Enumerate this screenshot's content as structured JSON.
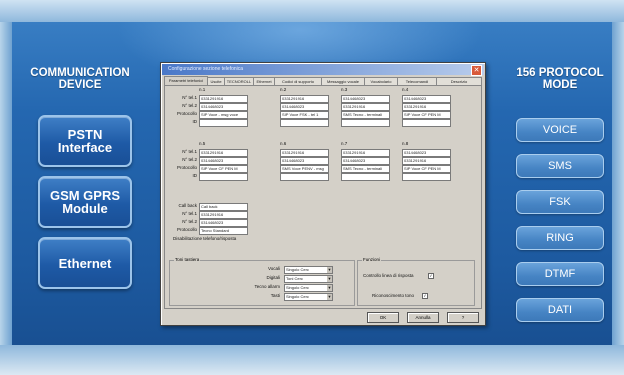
{
  "left_title": "COMMUNICATION\nDEVICE",
  "right_title": "156 PROTOCOL\nMODE",
  "devices": [
    {
      "label": "PSTN\nInterface"
    },
    {
      "label": "GSM GPRS\nModule"
    },
    {
      "label": "Ethernet"
    }
  ],
  "modes": [
    "VOICE",
    "SMS",
    "FSK",
    "RING",
    "DTMF",
    "DATI"
  ],
  "dialog": {
    "title": "Configurazione sezione telefonica",
    "tabs": [
      "Parametri telefonici",
      "Uscite",
      "TECNOROLL",
      "Ethernet",
      "Codici di supporto",
      "Messaggio vocale",
      "Vocabolario",
      "Telecomandi",
      "Descrizio"
    ],
    "label_n1": "N° tel.1",
    "label_n2": "N° tel.2",
    "label_protocol": "Protocollo",
    "label_id": "ID",
    "slots": [
      {
        "n": "1",
        "tel1": "0331291916",
        "tel2": "0314468023",
        "protocol": "SIP Voce - msg voce"
      },
      {
        "n": "2",
        "tel1": "0331291916",
        "tel2": "0314468023",
        "protocol": "SIP Voce FSK - tel 1"
      },
      {
        "n": "3",
        "tel1": "0314468023",
        "tel2": "0331291916",
        "protocol": "SMS Tecno - terminali"
      },
      {
        "n": "4",
        "tel1": "0314468023",
        "tel2": "0331291916",
        "protocol": "SIP Voce CF PEN M"
      },
      {
        "n": "5",
        "tel1": "0331291916",
        "tel2": "0314468023",
        "protocol": "SIP Voce CF PEN M"
      },
      {
        "n": "6",
        "tel1": "0331291916",
        "tel2": "0314468023",
        "protocol": "SMS Voce PENV - msg"
      },
      {
        "n": "7",
        "tel1": "0331291916",
        "tel2": "0314468023",
        "protocol": "SMS Tecno - terminali"
      },
      {
        "n": "8",
        "tel1": "0314468023",
        "tel2": "0331291916",
        "protocol": "SIP Voce CF PEN M"
      }
    ],
    "callback": {
      "label_callback": "Call back",
      "callback_value": "Call back",
      "tel1": "0331291916",
      "tel2": "0314468023",
      "protocol": "Tecno Standard",
      "disable_label": "Disabilitazione telefono/risposta"
    },
    "toni": {
      "group_label": "Toni tastiera",
      "rows": [
        {
          "label": "Vocali",
          "value": "Singolo Cerc"
        },
        {
          "label": "Digitali",
          "value": "Toni Cerc"
        },
        {
          "label": "Tecno allarm",
          "value": "Singolo Cerc"
        },
        {
          "label": "Tasti",
          "value": "Singolo Cerc"
        }
      ]
    },
    "funzioni": {
      "group_label": "Funzioni",
      "check1": "Controllo linea di risposta",
      "check2": "Riconoscimento tono"
    },
    "ok_label": "OK",
    "cancel_label": "Annulla",
    "help_label": "?"
  },
  "colors": {
    "background": "#1f5fa6",
    "button_border": "#9cc4ea",
    "mode_button": "#4684c4",
    "dialog": "#d4d0c8"
  }
}
